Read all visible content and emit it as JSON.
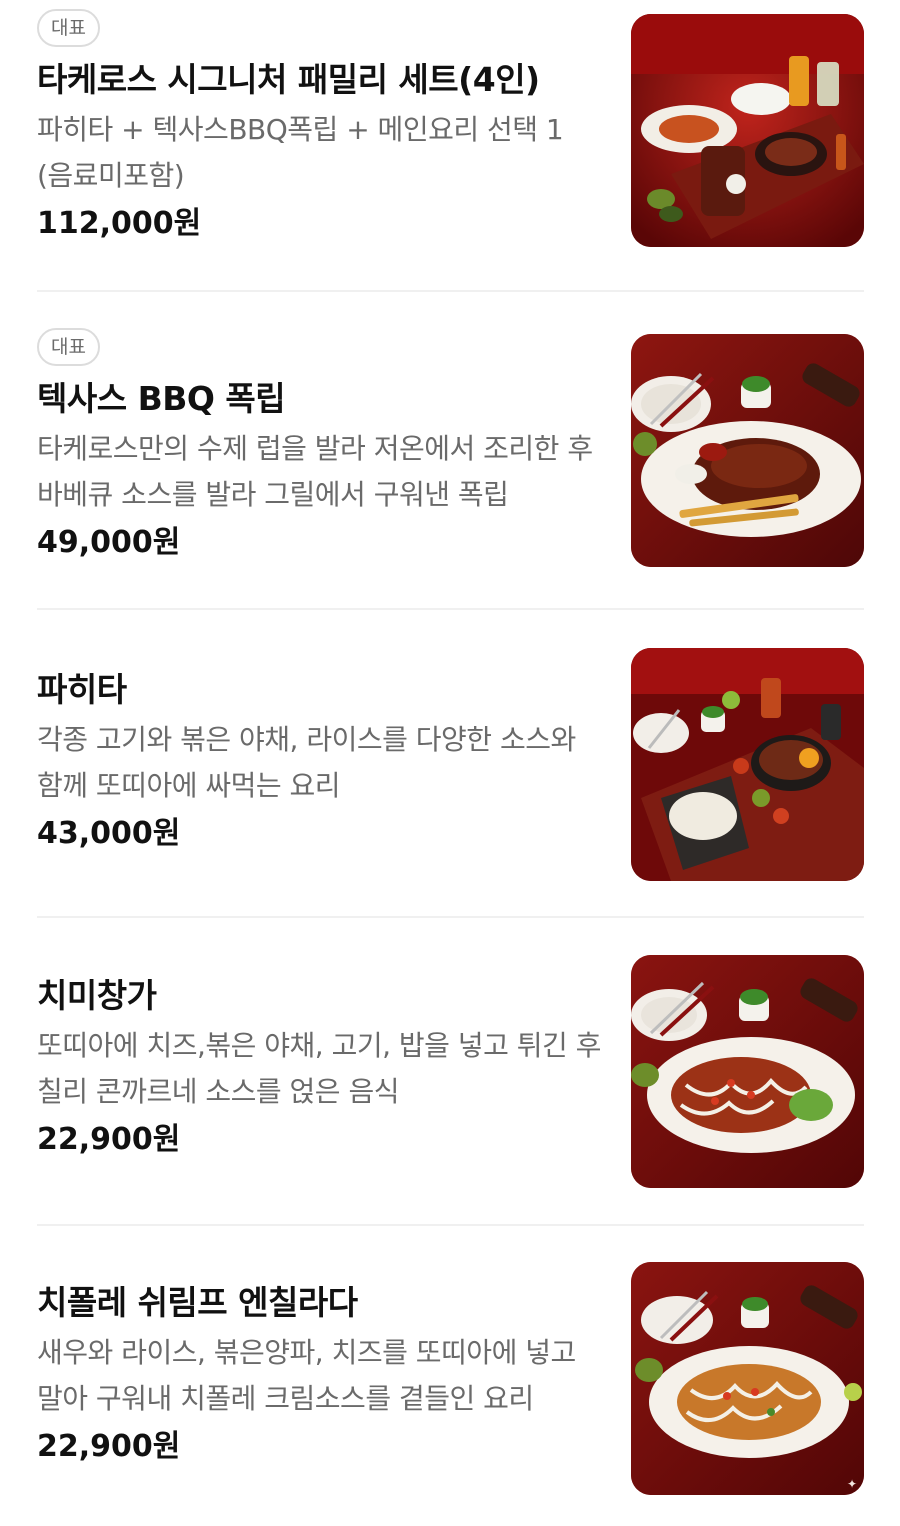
{
  "menu": {
    "items": [
      {
        "badge": "대표",
        "name": "타케로스 시그니처 패밀리 세트(4인)",
        "description": "파히타 + 텍사스BBQ폭립 + 메인요리 선택 1 (음료미포함)",
        "price": "112,000원",
        "image_icon": "family-set-food-photo"
      },
      {
        "badge": "대표",
        "name": "텍사스 BBQ 폭립",
        "description": "타케로스만의 수제 럽을 발라 저온에서 조리한 후 바베큐 소스를 발라 그릴에서 구워낸 폭립",
        "price": "49,000원",
        "image_icon": "bbq-ribs-food-photo"
      },
      {
        "name": "파히타",
        "description": "각종 고기와 볶은 야채, 라이스를 다양한 소스와 함께 또띠아에 싸먹는 요리",
        "price": "43,000원",
        "image_icon": "fajita-food-photo"
      },
      {
        "name": "치미창가",
        "description": "또띠아에 치즈,볶은 야채, 고기, 밥을 넣고 튀긴 후 칠리 콘까르네 소스를 얹은 음식",
        "price": "22,900원",
        "image_icon": "chimichanga-food-photo"
      },
      {
        "name": "치폴레 쉬림프 엔칠라다",
        "description": "새우와 라이스, 볶은양파, 치즈를 또띠아에 넣고 말아 구워내 치폴레 크림소스를 곁들인 요리",
        "price": "22,900원",
        "image_icon": "shrimp-enchilada-food-photo"
      }
    ]
  },
  "colors": {
    "text_primary": "#111111",
    "text_secondary": "#6a6a6a",
    "badge_border": "#dcdcdc",
    "divider": "#f0f0f0",
    "photo_table": "#8a0f0f"
  }
}
